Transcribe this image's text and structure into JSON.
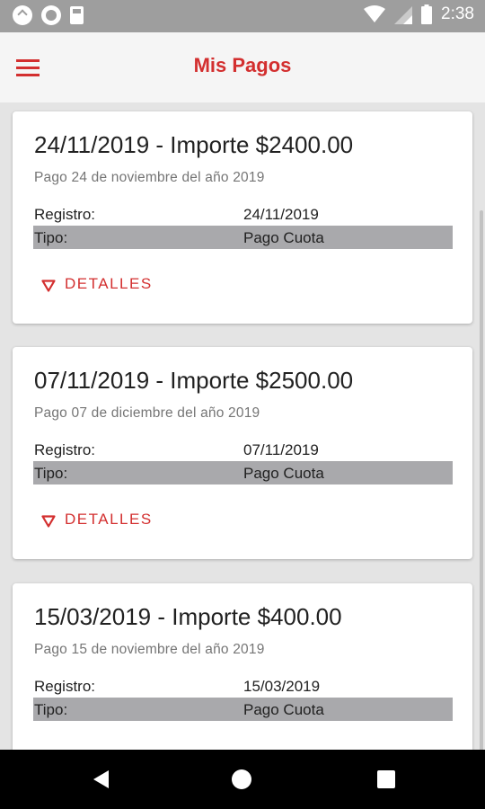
{
  "status_bar": {
    "time": "2:38",
    "icons": [
      "app-notification-icon",
      "circle-notification-icon",
      "sd-card-icon",
      "wifi-icon",
      "signal-icon",
      "battery-icon"
    ]
  },
  "app_bar": {
    "title": "Mis Pagos",
    "menu_icon": "hamburger-menu-icon"
  },
  "colors": {
    "accent": "#d32f2f",
    "status_bar": "#9e9e9e",
    "app_bar": "#f5f5f5",
    "background": "#e4e4e4",
    "row_shade": "#a9a9ac"
  },
  "payments": [
    {
      "title": "24/11/2019 - Importe $2400.00",
      "subtitle": "Pago 24 de noviembre del año 2019",
      "registro_label": "Registro:",
      "registro_value": "24/11/2019",
      "tipo_label": "Tipo:",
      "tipo_value": "Pago Cuota",
      "details_label": "DETALLES",
      "details_icon": "▽"
    },
    {
      "title": "07/11/2019 - Importe $2500.00",
      "subtitle": "Pago 07 de diciembre del año 2019",
      "registro_label": "Registro:",
      "registro_value": "07/11/2019",
      "tipo_label": "Tipo:",
      "tipo_value": "Pago Cuota",
      "details_label": "DETALLES",
      "details_icon": "▽"
    },
    {
      "title": "15/03/2019 - Importe $400.00",
      "subtitle": "Pago 15 de noviembre del año 2019",
      "registro_label": "Registro:",
      "registro_value": "15/03/2019",
      "tipo_label": "Tipo:",
      "tipo_value": "Pago Cuota"
    }
  ],
  "nav_bar": {
    "buttons": [
      "back-icon",
      "home-icon",
      "recents-icon"
    ]
  }
}
